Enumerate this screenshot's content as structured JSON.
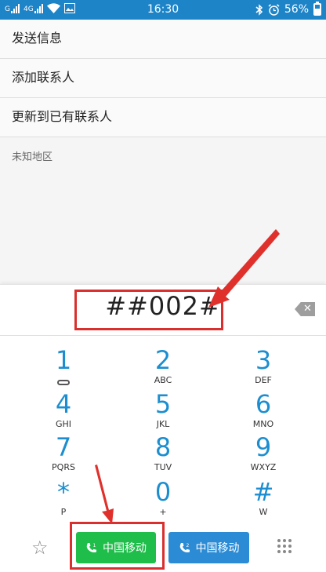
{
  "status_bar": {
    "signal_1_label": "G",
    "signal_2_label": "4G",
    "time": "16:30",
    "battery_text": "56%",
    "icons": [
      "signal-icon",
      "wifi-icon",
      "image-icon",
      "bluetooth-icon",
      "alarm-icon",
      "battery-icon"
    ]
  },
  "menu": {
    "items": [
      {
        "label": "发送信息"
      },
      {
        "label": "添加联系人"
      },
      {
        "label": "更新到已有联系人"
      }
    ],
    "region": "未知地区"
  },
  "dialer": {
    "number": "##002#",
    "keys": [
      {
        "digit": "1",
        "letters": ""
      },
      {
        "digit": "2",
        "letters": "ABC"
      },
      {
        "digit": "3",
        "letters": "DEF"
      },
      {
        "digit": "4",
        "letters": "GHI"
      },
      {
        "digit": "5",
        "letters": "JKL"
      },
      {
        "digit": "6",
        "letters": "MNO"
      },
      {
        "digit": "7",
        "letters": "PQRS"
      },
      {
        "digit": "8",
        "letters": "TUV"
      },
      {
        "digit": "9",
        "letters": "WXYZ"
      },
      {
        "digit": "*",
        "letters": "P"
      },
      {
        "digit": "0",
        "letters": "+"
      },
      {
        "digit": "#",
        "letters": "W"
      }
    ],
    "call_buttons": [
      {
        "label": "中国移动",
        "sim": "1"
      },
      {
        "label": "中国移动",
        "sim": "2"
      }
    ]
  },
  "colors": {
    "status_bar": "#1e84c8",
    "digit": "#1c8ed0",
    "call_sim1": "#1fbe4b",
    "call_sim2": "#2b8bd4",
    "annotation": "#d9302f"
  }
}
